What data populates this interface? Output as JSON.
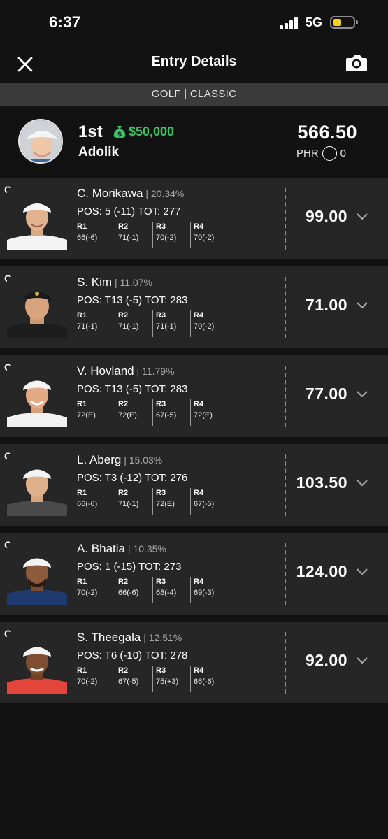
{
  "status": {
    "time": "6:37",
    "network": "5G"
  },
  "header": {
    "title": "Entry Details"
  },
  "sub_bar": {
    "label": "GOLF | CLASSIC"
  },
  "summary": {
    "rank": "1st",
    "prize": "$50,000",
    "username": "Adolik",
    "score": "566.50",
    "phr_label": "PHR",
    "phr_value": "0"
  },
  "players": [
    {
      "position": "G",
      "name": "C. Morikawa",
      "ownership": "20.34%",
      "pos_line": "POS: 5 (-11) TOT: 277",
      "rounds": [
        {
          "label": "R1",
          "score": "66(-6)"
        },
        {
          "label": "R2",
          "score": "71(-1)"
        },
        {
          "label": "R3",
          "score": "70(-2)"
        },
        {
          "label": "R4",
          "score": "70(-2)"
        }
      ],
      "points": "99.00"
    },
    {
      "position": "G",
      "name": "S. Kim",
      "ownership": "11.07%",
      "pos_line": "POS: T13 (-5) TOT: 283",
      "rounds": [
        {
          "label": "R1",
          "score": "71(-1)"
        },
        {
          "label": "R2",
          "score": "71(-1)"
        },
        {
          "label": "R3",
          "score": "71(-1)"
        },
        {
          "label": "R4",
          "score": "70(-2)"
        }
      ],
      "points": "71.00"
    },
    {
      "position": "G",
      "name": "V. Hovland",
      "ownership": "11.79%",
      "pos_line": "POS: T13 (-5) TOT: 283",
      "rounds": [
        {
          "label": "R1",
          "score": "72(E)"
        },
        {
          "label": "R2",
          "score": "72(E)"
        },
        {
          "label": "R3",
          "score": "67(-5)"
        },
        {
          "label": "R4",
          "score": "72(E)"
        }
      ],
      "points": "77.00"
    },
    {
      "position": "G",
      "name": "L. Aberg",
      "ownership": "15.03%",
      "pos_line": "POS: T3 (-12) TOT: 276",
      "rounds": [
        {
          "label": "R1",
          "score": "66(-6)"
        },
        {
          "label": "R2",
          "score": "71(-1)"
        },
        {
          "label": "R3",
          "score": "72(E)"
        },
        {
          "label": "R4",
          "score": "67(-5)"
        }
      ],
      "points": "103.50"
    },
    {
      "position": "G",
      "name": "A. Bhatia",
      "ownership": "10.35%",
      "pos_line": "POS: 1 (-15) TOT: 273",
      "rounds": [
        {
          "label": "R1",
          "score": "70(-2)"
        },
        {
          "label": "R2",
          "score": "66(-6)"
        },
        {
          "label": "R3",
          "score": "68(-4)"
        },
        {
          "label": "R4",
          "score": "69(-3)"
        }
      ],
      "points": "124.00"
    },
    {
      "position": "G",
      "name": "S. Theegala",
      "ownership": "12.51%",
      "pos_line": "POS: T6 (-10) TOT: 278",
      "rounds": [
        {
          "label": "R1",
          "score": "70(-2)"
        },
        {
          "label": "R2",
          "score": "67(-5)"
        },
        {
          "label": "R3",
          "score": "75(+3)"
        },
        {
          "label": "R4",
          "score": "66(-6)"
        }
      ],
      "points": "92.00"
    }
  ],
  "colors": {
    "background": "#121212",
    "card": "#262626",
    "accent_green": "#3ac265",
    "battery": "#f2d21a"
  }
}
